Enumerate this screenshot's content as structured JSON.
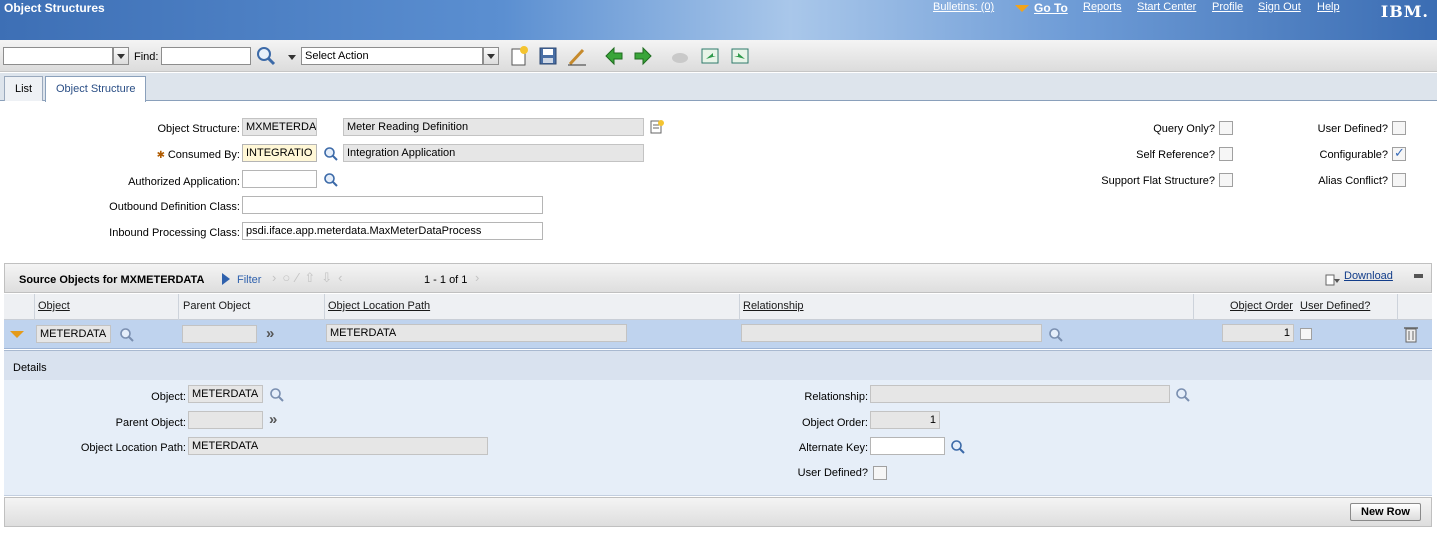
{
  "header": {
    "title": "Object Structures",
    "bulletins": "Bulletins: (0)",
    "goto": "Go To",
    "reports": "Reports",
    "start_center": "Start Center",
    "profile": "Profile",
    "sign_out": "Sign Out",
    "help": "Help",
    "logo": "IBM."
  },
  "toolbar": {
    "find_label": "Find:",
    "find_value": "",
    "query_value": "",
    "action_value": "Select Action"
  },
  "tabs": [
    {
      "label": "List",
      "active": false
    },
    {
      "label": "Object Structure",
      "active": true
    }
  ],
  "form": {
    "object_structure_label": "Object Structure:",
    "object_structure_value": "MXMETERDA",
    "object_structure_desc": "Meter Reading Definition",
    "consumed_by_label": "Consumed By:",
    "consumed_by_value": "INTEGRATIO",
    "consumed_by_desc": "Integration Application",
    "authorized_app_label": "Authorized Application:",
    "authorized_app_value": "",
    "outbound_label": "Outbound Definition Class:",
    "outbound_value": "",
    "inbound_label": "Inbound Processing Class:",
    "inbound_value": "psdi.iface.app.meterdata.MaxMeterDataProcess",
    "query_only_label": "Query Only?",
    "self_reference_label": "Self Reference?",
    "support_flat_label": "Support Flat Structure?",
    "user_defined_label": "User Defined?",
    "configurable_label": "Configurable?",
    "alias_conflict_label": "Alias Conflict?",
    "query_only": false,
    "self_reference": false,
    "support_flat": false,
    "user_defined": false,
    "configurable": true,
    "alias_conflict": false
  },
  "source_table": {
    "title": "Source Objects for MXMETERDATA",
    "filter": "Filter",
    "pagination": "1 - 1 of 1",
    "download": "Download",
    "columns": {
      "object": "Object",
      "parent_object": "Parent Object",
      "location_path": "Object Location Path",
      "relationship": "Relationship",
      "object_order": "Object Order",
      "user_defined": "User Defined?"
    },
    "rows": [
      {
        "object": "METERDATA",
        "parent_object": "",
        "location_path": "METERDATA",
        "relationship": "",
        "object_order": "1",
        "user_defined": false
      }
    ]
  },
  "details": {
    "title": "Details",
    "object_label": "Object:",
    "object_value": "METERDATA",
    "parent_label": "Parent Object:",
    "parent_value": "",
    "location_label": "Object Location Path:",
    "location_value": "METERDATA",
    "relationship_label": "Relationship:",
    "relationship_value": "",
    "order_label": "Object Order:",
    "order_value": "1",
    "alt_key_label": "Alternate Key:",
    "alt_key_value": "",
    "user_defined_label": "User Defined?"
  },
  "footer": {
    "new_row": "New Row"
  },
  "colors": {
    "header_blue": "#3d6fb5",
    "row_selected": "#bfd3ee",
    "details_bg": "#e6eef8",
    "link": "#123d8a"
  }
}
